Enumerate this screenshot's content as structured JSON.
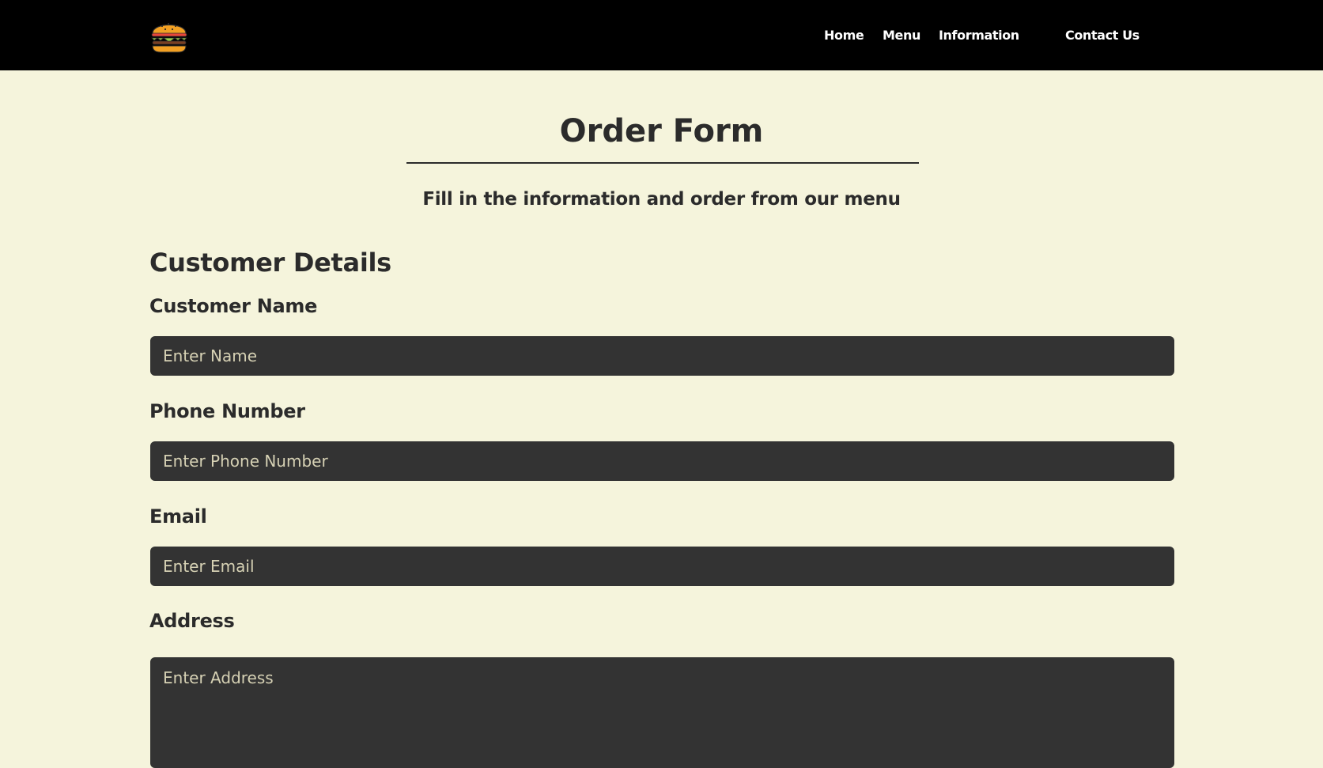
{
  "nav": {
    "logo": "burger-logo",
    "links": {
      "home": "Home",
      "menu": "Menu",
      "information": "Information",
      "contact": "Contact Us"
    }
  },
  "main": {
    "title": "Order Form",
    "subtitle": "Fill in the information and order from our menu",
    "section_heading": "Customer Details",
    "fields": {
      "name": {
        "label": "Customer Name",
        "placeholder": "Enter Name"
      },
      "phone": {
        "label": "Phone Number",
        "placeholder": "Enter Phone Number"
      },
      "email": {
        "label": "Email",
        "placeholder": "Enter Email"
      },
      "address": {
        "label": "Address",
        "placeholder": "Enter Address"
      }
    }
  },
  "colors": {
    "page_background": "#f5f4dc",
    "nav_background": "#000000",
    "text": "#2b2b2b",
    "field_background": "#333333",
    "placeholder": "#d6d1b4"
  }
}
